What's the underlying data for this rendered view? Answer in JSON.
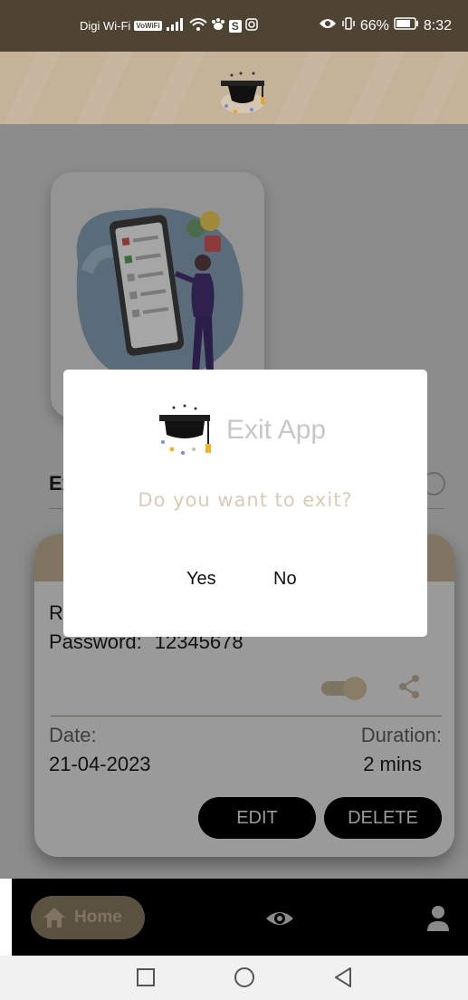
{
  "status_bar": {
    "carrier": "Digi Wi-Fi",
    "vowifi_badge": "VoWiFi",
    "s_badge": "S",
    "battery_percent": "66%",
    "time": "8:32"
  },
  "screen": {
    "section_heading_partial": "Ex",
    "record": {
      "line1_partial": "Re",
      "password_label": "Password:",
      "password_value": "12345678",
      "date_label": "Date:",
      "date_value": "21-04-2023",
      "duration_label": "Duration:",
      "duration_value": "2 mins",
      "edit_label": "EDIT",
      "delete_label": "DELETE",
      "toggle_on": true
    }
  },
  "bottom_nav": {
    "home_label": "Home"
  },
  "dialog": {
    "title": "Exit App",
    "message": "Do you want to exit?",
    "yes_label": "Yes",
    "no_label": "No"
  },
  "colors": {
    "accent": "#c4b299",
    "status_bar": "#4f4434",
    "scrim_gray": "#8c8c8c"
  }
}
